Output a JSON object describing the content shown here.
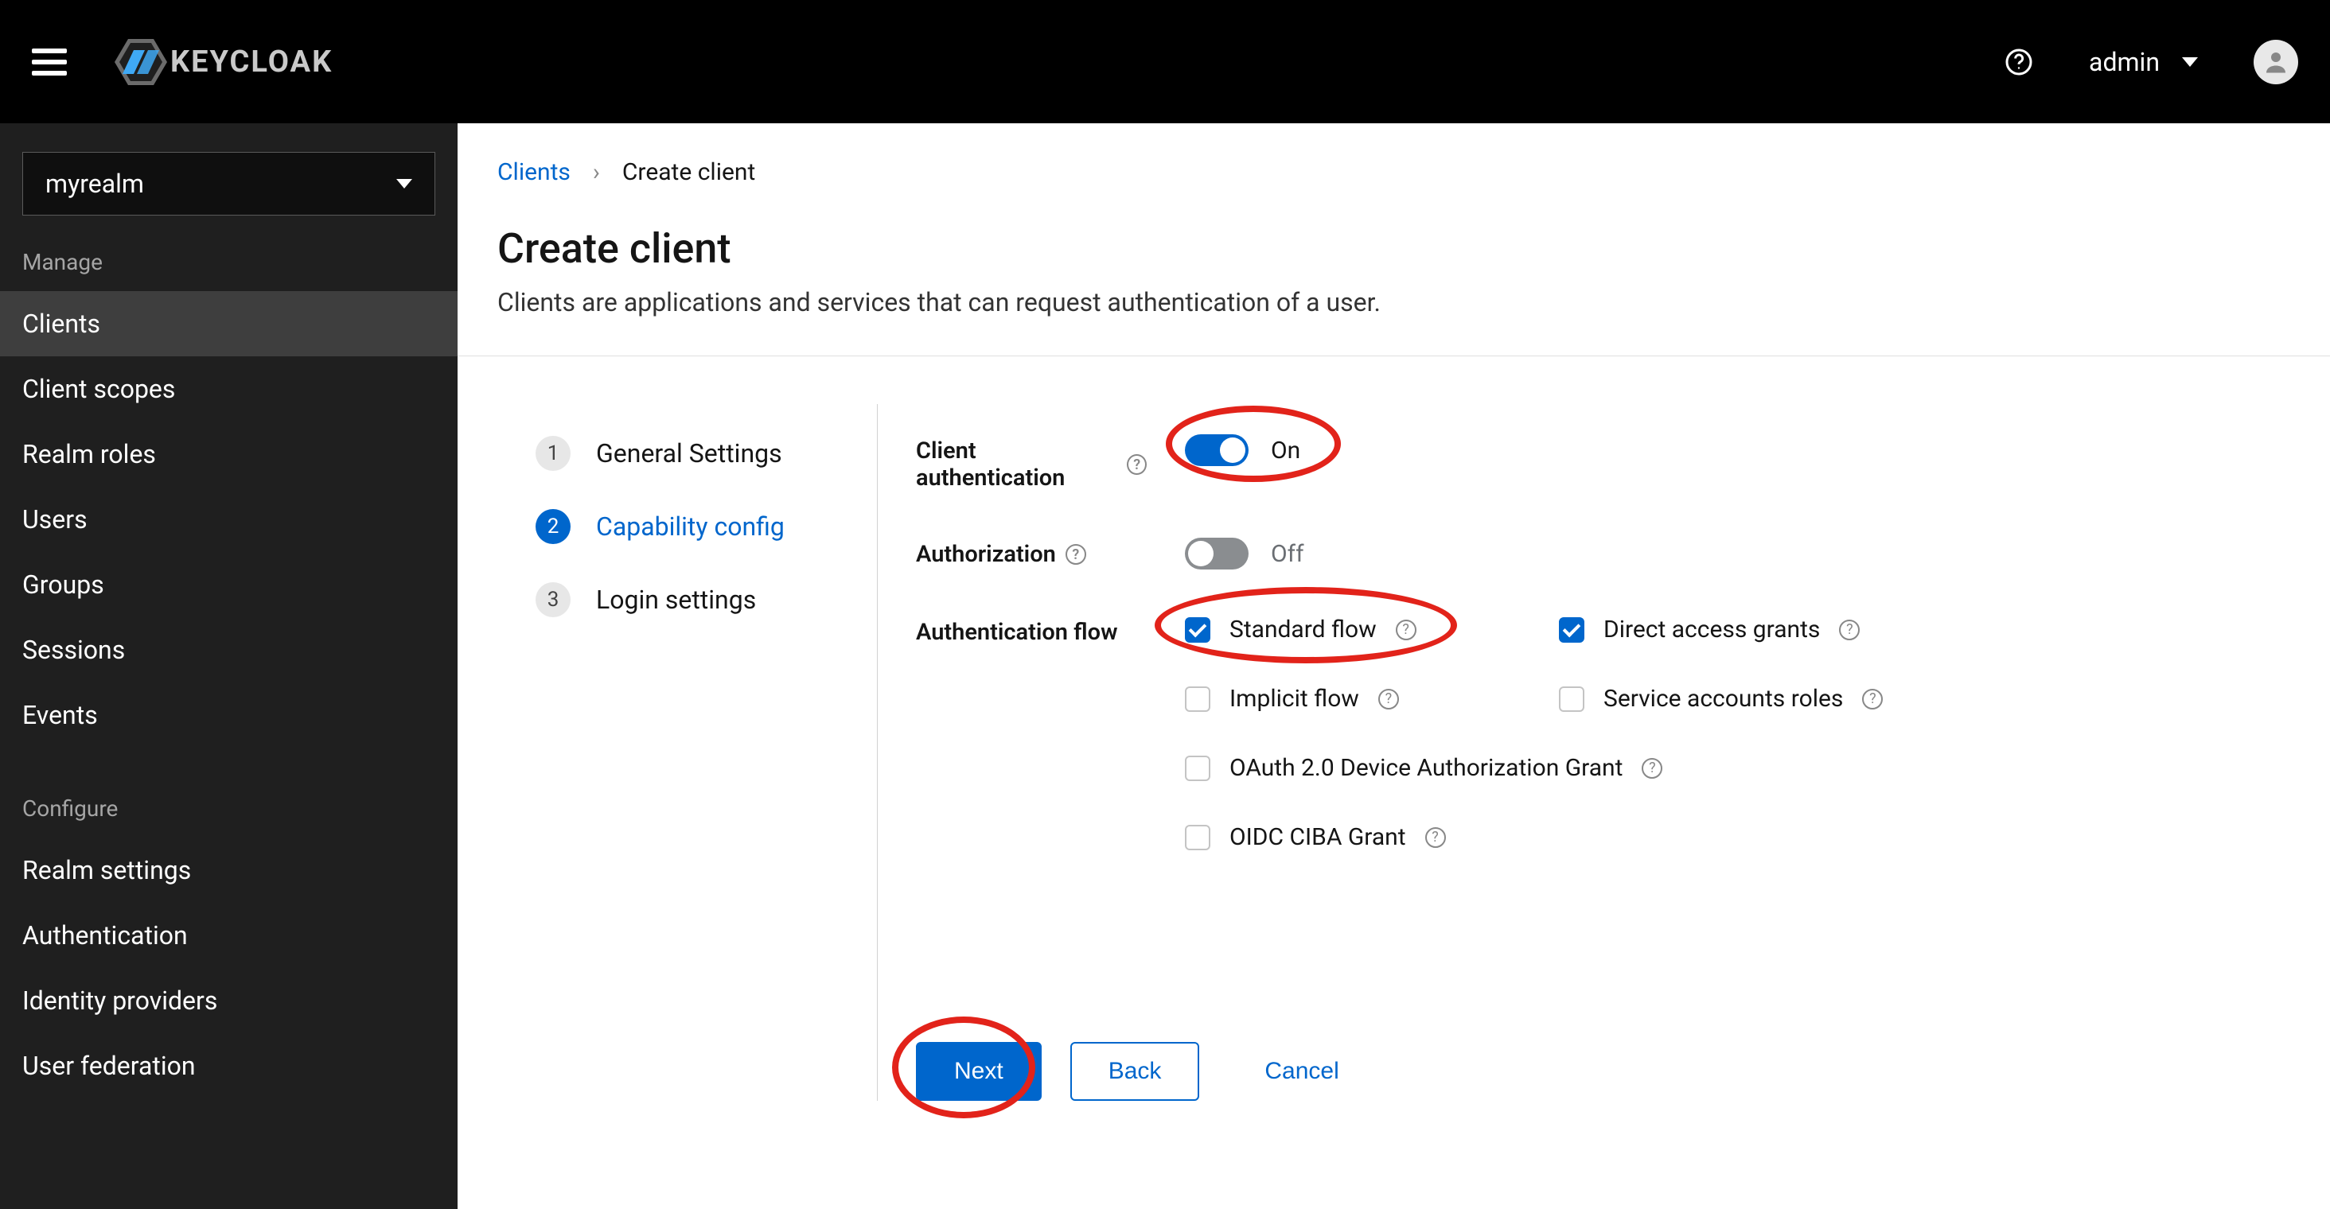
{
  "header": {
    "brand": "KEYCLOAK",
    "user": "admin"
  },
  "sidebar": {
    "realm": "myrealm",
    "manage_label": "Manage",
    "configure_label": "Configure",
    "manage_items": [
      {
        "id": "clients",
        "label": "Clients",
        "active": true
      },
      {
        "id": "client-scopes",
        "label": "Client scopes"
      },
      {
        "id": "realm-roles",
        "label": "Realm roles"
      },
      {
        "id": "users",
        "label": "Users"
      },
      {
        "id": "groups",
        "label": "Groups"
      },
      {
        "id": "sessions",
        "label": "Sessions"
      },
      {
        "id": "events",
        "label": "Events"
      }
    ],
    "configure_items": [
      {
        "id": "realm-settings",
        "label": "Realm settings"
      },
      {
        "id": "authentication",
        "label": "Authentication"
      },
      {
        "id": "identity-providers",
        "label": "Identity providers"
      },
      {
        "id": "user-federation",
        "label": "User federation"
      }
    ]
  },
  "breadcrumb": {
    "parent": "Clients",
    "current": "Create client"
  },
  "page": {
    "title": "Create client",
    "description": "Clients are applications and services that can request authentication of a user."
  },
  "steps": [
    {
      "num": "1",
      "label": "General Settings",
      "active": false
    },
    {
      "num": "2",
      "label": "Capability config",
      "active": true
    },
    {
      "num": "3",
      "label": "Login settings",
      "active": false
    }
  ],
  "form": {
    "client_auth_label": "Client authentication",
    "client_auth_on": true,
    "on_text": "On",
    "off_text": "Off",
    "authorization_label": "Authorization",
    "authorization_on": false,
    "auth_flow_label": "Authentication flow",
    "flows": [
      {
        "id": "standard",
        "label": "Standard flow",
        "checked": true,
        "help": true,
        "full": false
      },
      {
        "id": "direct",
        "label": "Direct access grants",
        "checked": true,
        "help": true,
        "full": false
      },
      {
        "id": "implicit",
        "label": "Implicit flow",
        "checked": false,
        "help": true,
        "full": false
      },
      {
        "id": "svc-acct",
        "label": "Service accounts roles",
        "checked": false,
        "help": true,
        "full": false
      },
      {
        "id": "oauth-dev",
        "label": "OAuth 2.0 Device Authorization Grant",
        "checked": false,
        "help": true,
        "full": true
      },
      {
        "id": "oidc-ciba",
        "label": "OIDC CIBA Grant",
        "checked": false,
        "help": true,
        "full": true
      }
    ]
  },
  "actions": {
    "next": "Next",
    "back": "Back",
    "cancel": "Cancel"
  }
}
